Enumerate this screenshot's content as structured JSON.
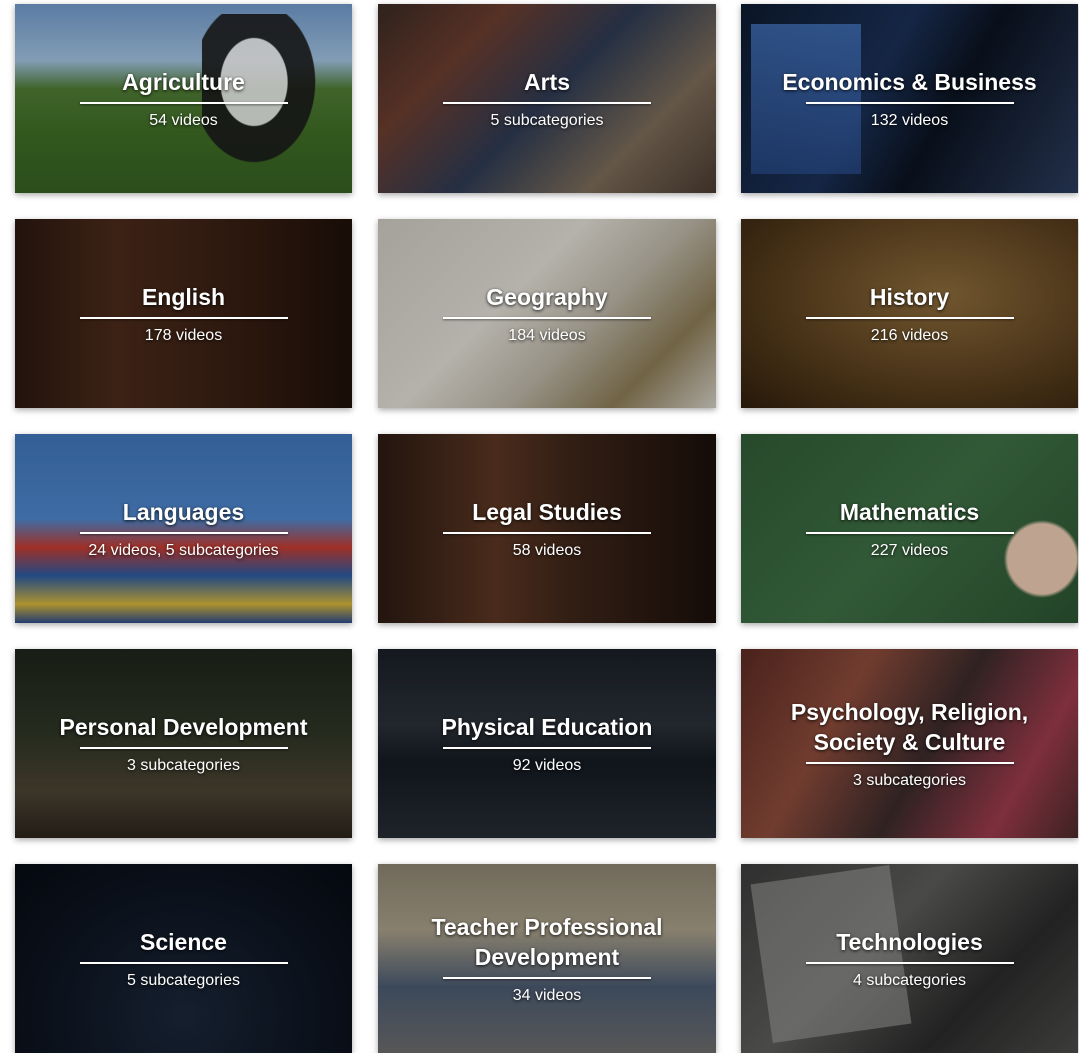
{
  "categories": [
    {
      "title": "Agriculture",
      "subtitle": "54 videos"
    },
    {
      "title": "Arts",
      "subtitle": "5 subcategories"
    },
    {
      "title": "Economics & Business",
      "subtitle": "132 videos"
    },
    {
      "title": "English",
      "subtitle": "178 videos"
    },
    {
      "title": "Geography",
      "subtitle": "184 videos"
    },
    {
      "title": "History",
      "subtitle": "216 videos"
    },
    {
      "title": "Languages",
      "subtitle": "24 videos, 5 subcategories"
    },
    {
      "title": "Legal Studies",
      "subtitle": "58 videos"
    },
    {
      "title": "Mathematics",
      "subtitle": "227 videos"
    },
    {
      "title": "Personal Development",
      "subtitle": "3 subcategories"
    },
    {
      "title": "Physical Education",
      "subtitle": "92 videos"
    },
    {
      "title": "Psychology, Religion, Society & Culture",
      "subtitle": "3 subcategories"
    },
    {
      "title": "Science",
      "subtitle": "5 subcategories"
    },
    {
      "title": "Teacher Professional Development",
      "subtitle": "34 videos"
    },
    {
      "title": "Technologies",
      "subtitle": "4 subcategories"
    }
  ]
}
